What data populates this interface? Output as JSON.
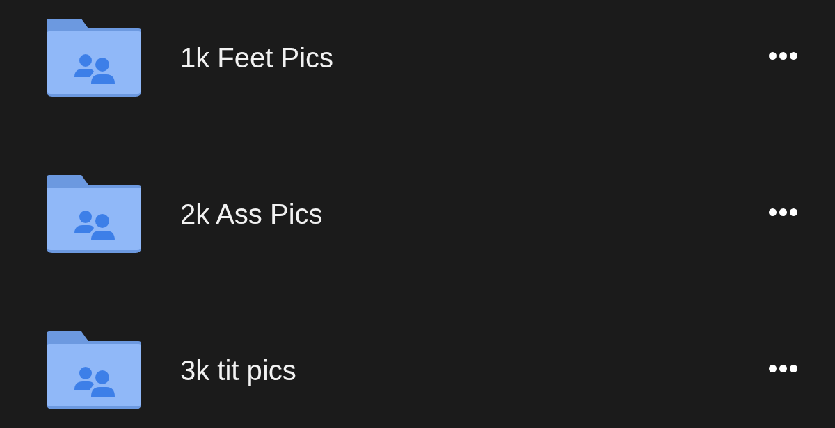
{
  "folders": [
    {
      "name": "1k Feet Pics",
      "kind": "shared"
    },
    {
      "name": "2k Ass Pics",
      "kind": "shared"
    },
    {
      "name": "3k tit pics",
      "kind": "shared"
    }
  ]
}
